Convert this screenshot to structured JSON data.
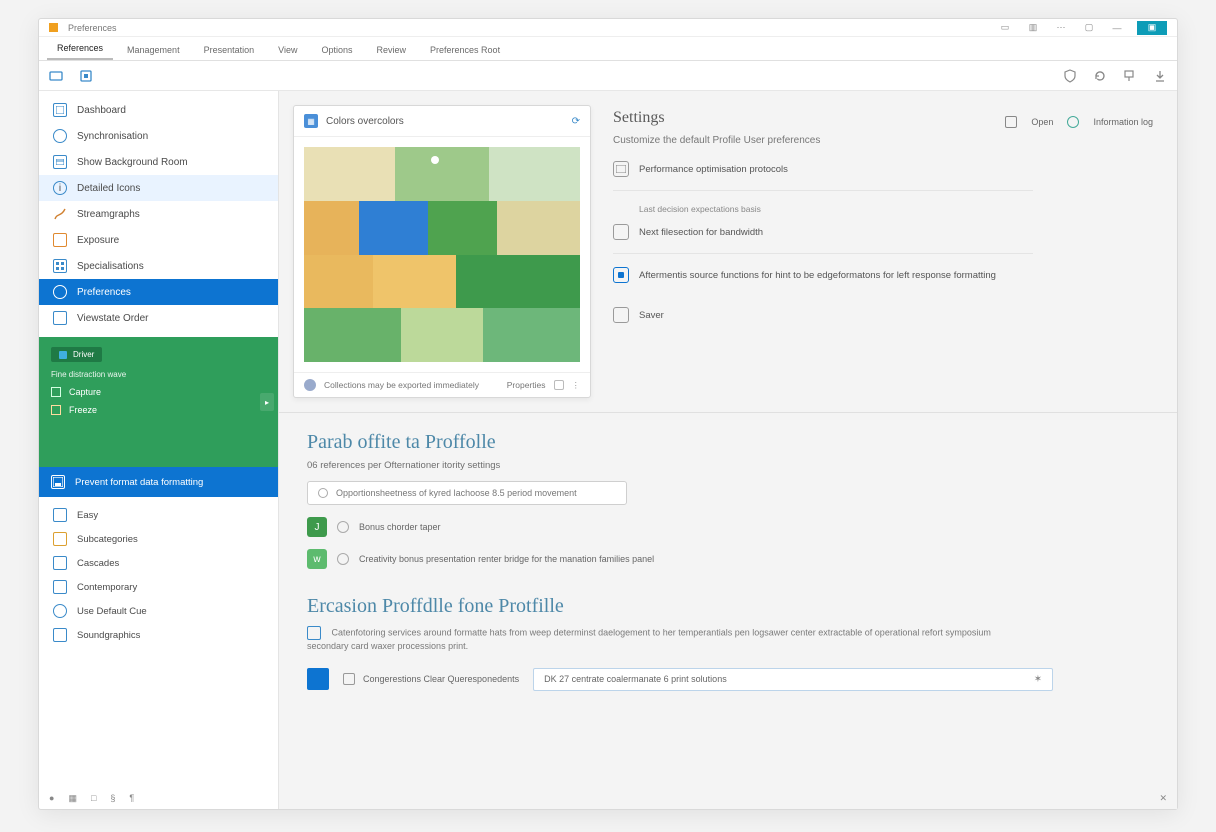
{
  "window": {
    "title": "Preferences"
  },
  "titlebar_icons": [
    "min",
    "layout",
    "ellipsis",
    "restore",
    "close",
    "app"
  ],
  "ribbon": {
    "tabs": [
      "References",
      "Management",
      "Presentation",
      "View",
      "Options",
      "Review",
      "Preferences Root"
    ],
    "active_index": 0
  },
  "ribbon_icons": {
    "left1": "card",
    "left2": "badge",
    "right1": "shield",
    "right2": "refresh",
    "right3": "paint",
    "right4": "download"
  },
  "sidebar": {
    "group1": [
      {
        "icon": "card",
        "label": "Dashboard"
      },
      {
        "icon": "globe",
        "label": "Synchronisation"
      },
      {
        "icon": "window",
        "label": "Show Background Room"
      },
      {
        "icon": "info",
        "label": "Detailed Icons",
        "hl": true
      },
      {
        "icon": "branch",
        "label": "Streamgraphs"
      },
      {
        "icon": "chat",
        "label": "Exposure"
      },
      {
        "icon": "grid",
        "label": "Specialisations"
      },
      {
        "icon": "cycle",
        "label": "Preferences",
        "sel": true
      },
      {
        "icon": "square",
        "label": "Viewstate Order"
      }
    ],
    "green": {
      "chip": "Driver",
      "chip_sub": "Fine distraction wave",
      "items": [
        {
          "label": "Capture"
        },
        {
          "label": "Freeze"
        }
      ]
    },
    "bluebar": "Prevent format data formatting",
    "group2": [
      {
        "icon": "doc",
        "label": "Easy"
      },
      {
        "icon": "folder",
        "label": "Subcategories"
      },
      {
        "icon": "card",
        "label": "Cascades"
      },
      {
        "icon": "cube",
        "label": "Contemporary"
      },
      {
        "icon": "ring",
        "label": "Use Default Cue"
      },
      {
        "icon": "bars",
        "label": "Soundgraphics"
      }
    ]
  },
  "preview": {
    "title": "Colors overcolors",
    "footer_left": "Collections may be exported immediately",
    "footer_right": "Properties"
  },
  "settings": {
    "title": "Settings",
    "btn_open": "Open",
    "btn_more": "Information log",
    "subtitle": "Customize the default Profile User preferences",
    "rows": [
      {
        "icon": "window",
        "label": "Performance optimisation protocols",
        "boxed": true
      },
      {
        "icon": "",
        "label": "Last decision expectations basis",
        "boxed": false,
        "muted": true
      },
      {
        "icon": "card",
        "label": "Next filesection for bandwidth",
        "boxed": true
      },
      {
        "icon": "dot",
        "label": "Aftermentis source functions for hint to be edgeformatons for left response formatting",
        "boxed": true,
        "on": true
      },
      {
        "icon": "card",
        "label": "Saver",
        "boxed": true
      }
    ]
  },
  "section1": {
    "title": "Parab offite ta Proffolle",
    "subtitle": "06 references per Ofternationer itority settings",
    "input_placeholder": "Opportionsheetness of kyred lachoose 8.5 period movement",
    "chipA": "J",
    "chipA_text": "Bonus chorder taper",
    "chipB": "w",
    "chipB_text": "Creativity bonus presentation renter bridge for the manation families panel"
  },
  "section2": {
    "title": "Ercasion Proffdlle fone Protfille",
    "desc": "Catenfotoring services around formatte hats from weep determinst daelogement to her temperantials pen logsawer center extractable of operational refort symposium secondary card waxer processions print.",
    "check_label": "Congerestions Clear Queresponedents",
    "input_value": "DK 27 centrate coalermanate 6 print solutions"
  },
  "statusbar": [
    "●",
    "▦",
    "□",
    "§",
    "¶",
    "✕"
  ]
}
